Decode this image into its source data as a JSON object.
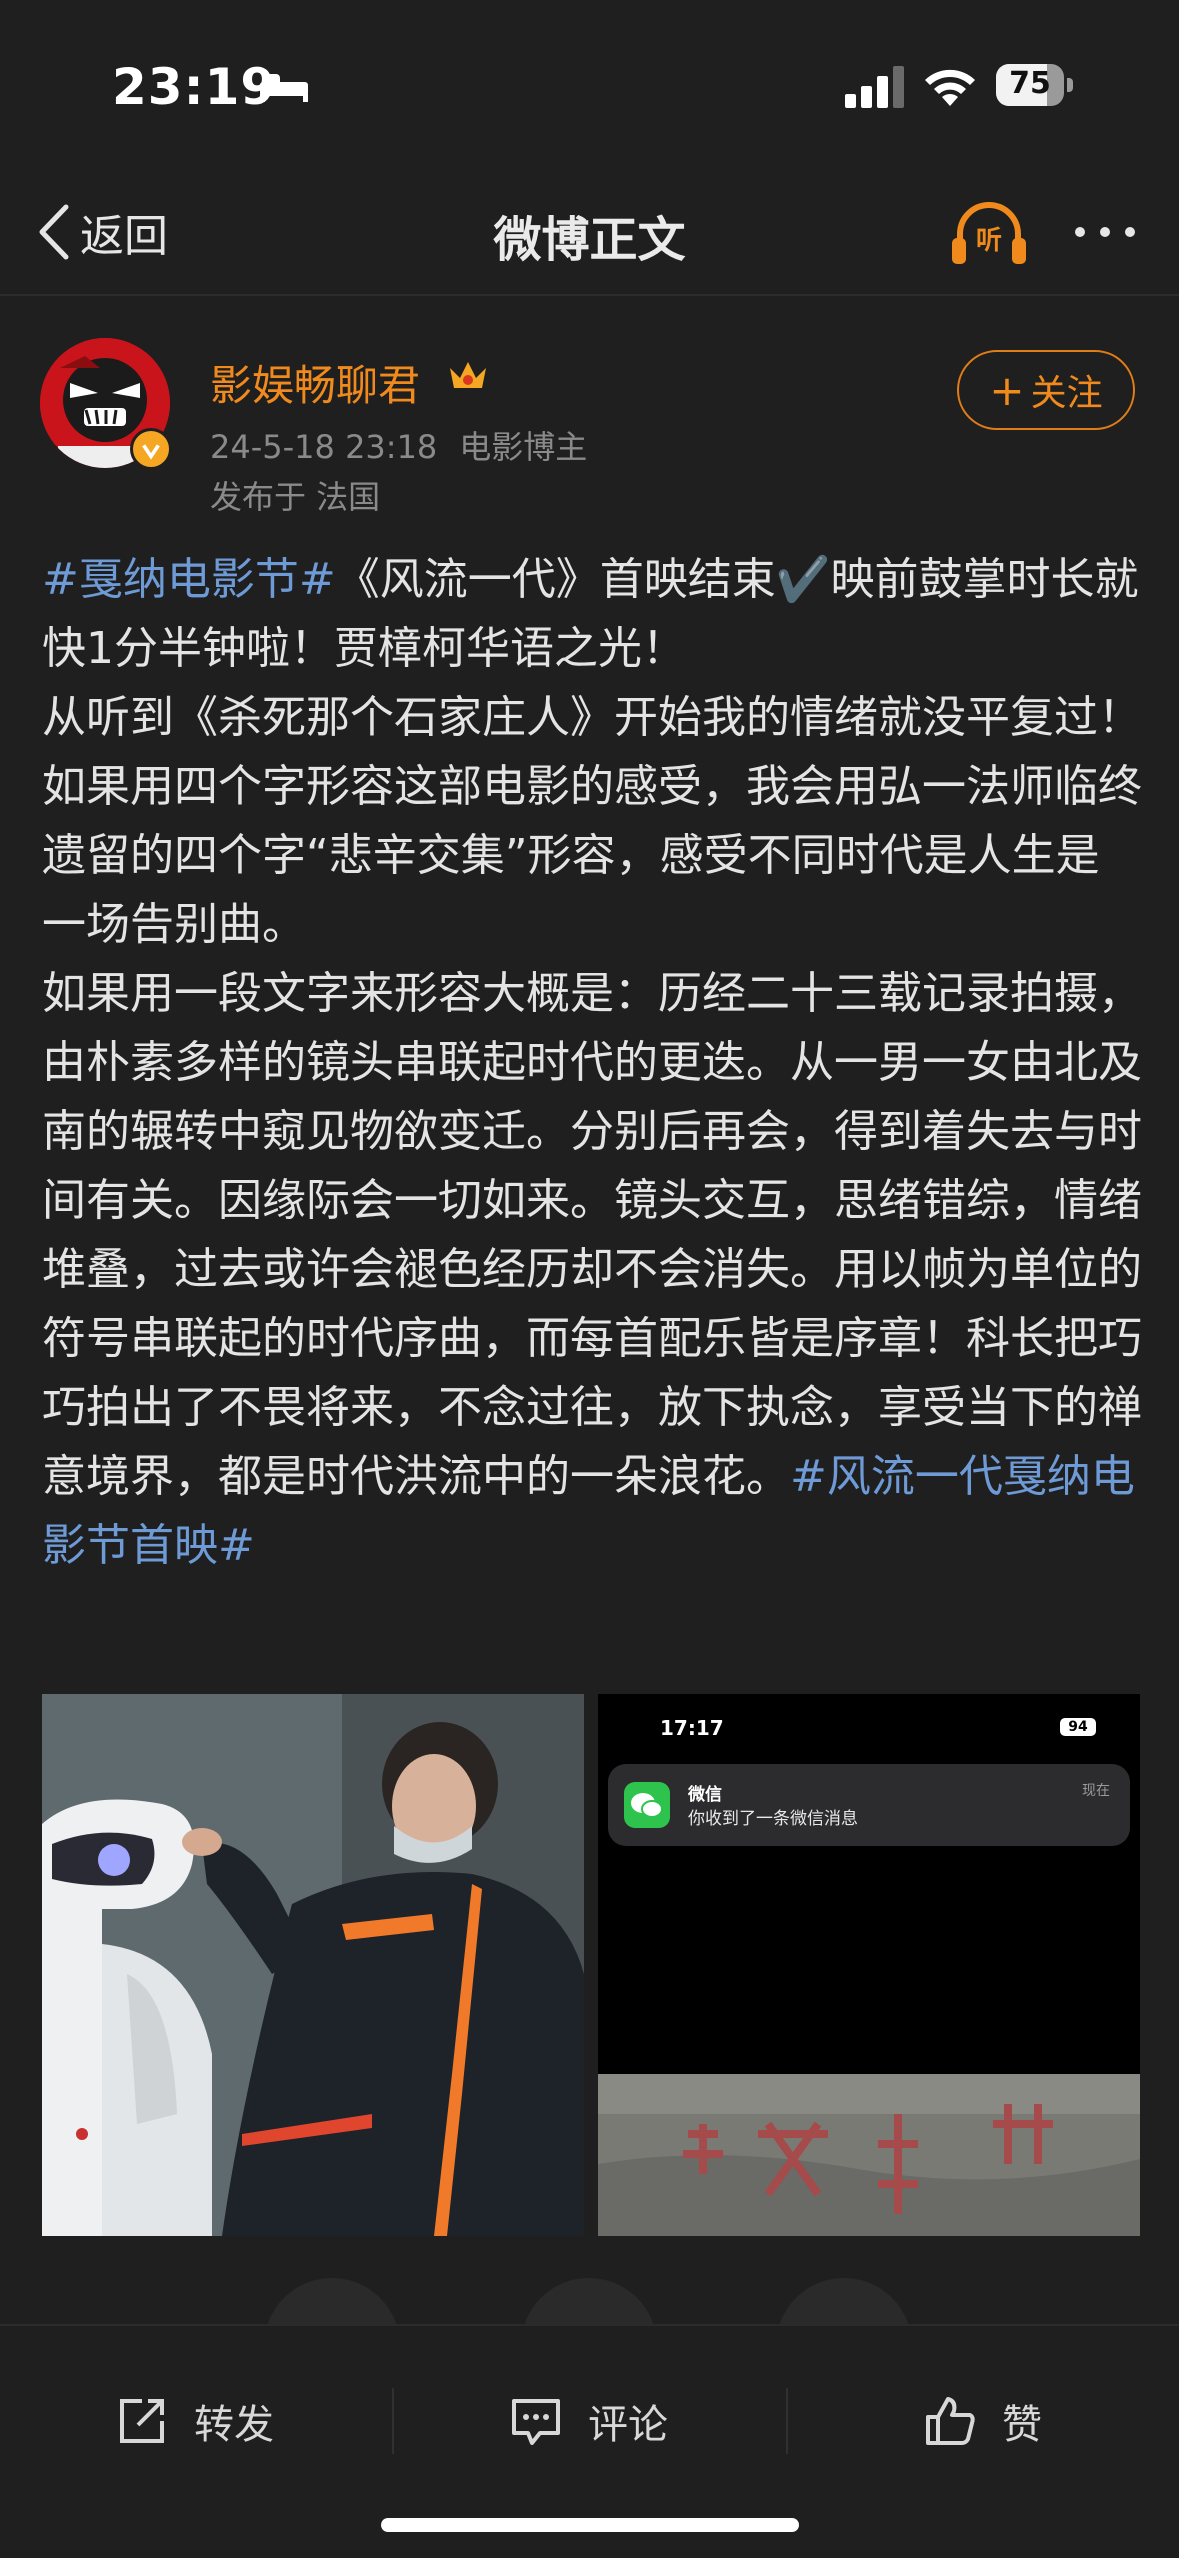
{
  "status_bar": {
    "time": "23:19",
    "battery": "75",
    "battery_level": 0.75
  },
  "nav": {
    "back_label": "返回",
    "title": "微博正文",
    "listen_label": "听"
  },
  "author": {
    "name": "影娱畅聊君",
    "date": "24-5-18 23:18",
    "role": "电影博主",
    "location": "发布于 法国",
    "follow_label": "关注"
  },
  "post": {
    "p1_tag": "#戛纳电影节#",
    "p1_a": "《风流一代》首映结束",
    "p1_check": "✔️",
    "p1_b": "映前鼓掌时长就快1分半钟啦！贾樟柯华语之光！",
    "p2": "从听到《杀死那个石家庄人》开始我的情绪就没平复过！如果用四个字形容这部电影的感受，我会用弘一法师临终遗留的四个字“悲辛交集”形容，感受不同时代是人生是一场告别曲。",
    "p3": "如果用一段文字来形容大概是：历经二十三载记录拍摄，由朴素多样的镜头串联起时代的更迭。从一男一女由北及南的辗转中窥见物欲变迁。分别后再会，得到着失去与时间有关。因缘际会一切如来。镜头交互，思绪错综，情绪堆叠，过去或许会褪色经历却不会消失。用以帧为单位的符号串联起的时代序曲，而每首配乐皆是序章！科长把巧巧拍出了不畏将来，不念过往，放下执念，享受当下的禅意境界，都是时代洪流中的一朵浪花。",
    "p3_tag": "#风流一代戛纳电影节首映#"
  },
  "image2": {
    "time": "17:17",
    "battery": "94",
    "app": "微信",
    "message": "你收到了一条微信消息",
    "when": "现在"
  },
  "actions": {
    "repost": "转发",
    "comment": "评论",
    "like": "赞"
  }
}
